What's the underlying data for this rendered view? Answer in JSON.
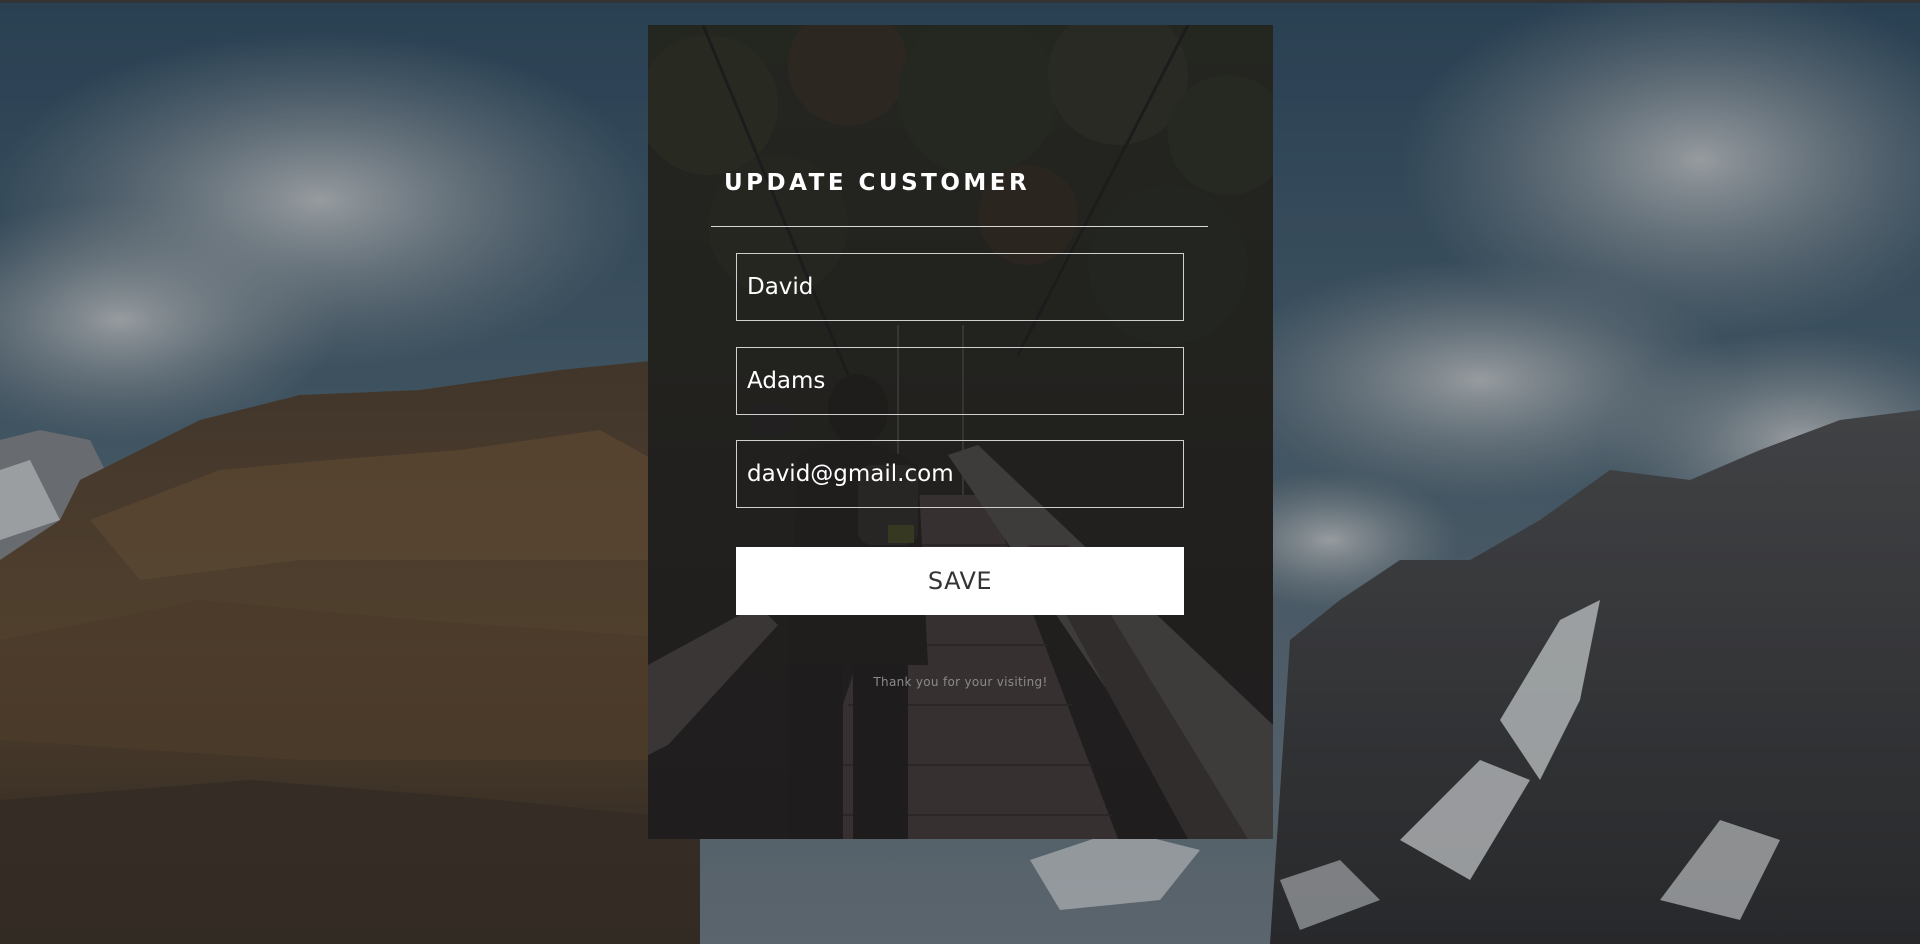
{
  "form": {
    "title": "UPDATE CUSTOMER",
    "first_name": {
      "value": "David",
      "placeholder": ""
    },
    "last_name": {
      "value": "Adams",
      "placeholder": ""
    },
    "email": {
      "value": "david@gmail.com",
      "placeholder": ""
    },
    "save_label": "SAVE",
    "footer_text": "Thank you for your visiting!"
  },
  "colors": {
    "card_overlay": "#211f20",
    "field_border": "#cfcfcf",
    "button_bg": "#ffffff",
    "button_text": "#333333",
    "title_text": "#ffffff",
    "footer_text": "#8a8a8a"
  }
}
